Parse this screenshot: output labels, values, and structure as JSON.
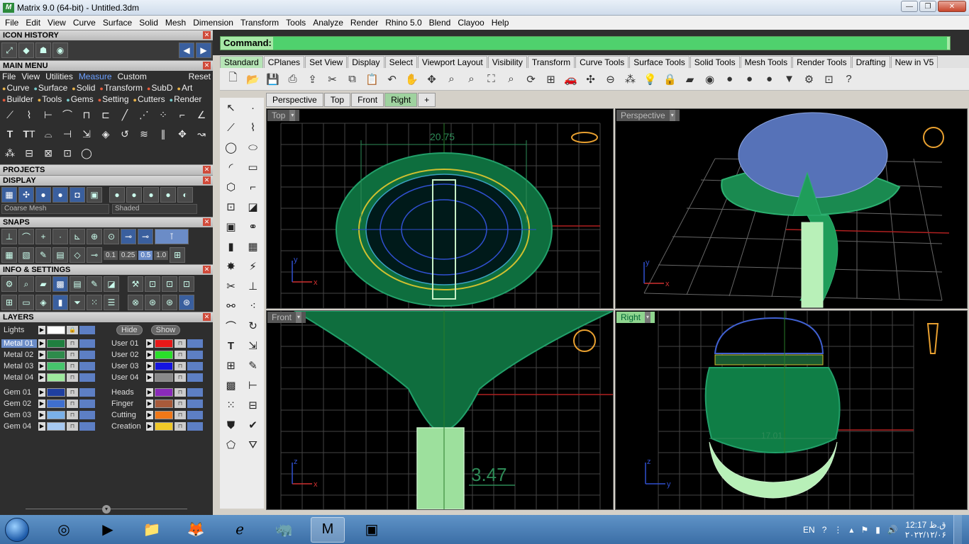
{
  "window": {
    "title": "Matrix 9.0 (64-bit) - Untitled.3dm",
    "minimize": "—",
    "maximize": "❐",
    "close": "✕"
  },
  "menubar": [
    "File",
    "Edit",
    "View",
    "Curve",
    "Surface",
    "Solid",
    "Mesh",
    "Dimension",
    "Transform",
    "Tools",
    "Analyze",
    "Render",
    "Rhino 5.0",
    "Blend",
    "Clayoo",
    "Help"
  ],
  "left_panel": {
    "icon_history": "ICON HISTORY",
    "main_menu": "MAIN MENU",
    "mm_menu": [
      "File",
      "View",
      "Utilities",
      "Measure",
      "Custom"
    ],
    "mm_reset": "Reset",
    "mm_cats_row1": [
      "Curve",
      "Surface",
      "Solid",
      "Transform",
      "SubD",
      "Art"
    ],
    "mm_cats_row2": [
      "Builder",
      "Tools",
      "Gems",
      "Setting",
      "Cutters",
      "Render"
    ],
    "projects": "PROJECTS",
    "display": "DISPLAY",
    "display_mesh": "Coarse Mesh",
    "display_shade": "Shaded",
    "snaps": "SNAPS",
    "snap_values": [
      "0.1",
      "0.25",
      "0.5",
      "1.0"
    ],
    "info_settings": "INFO & SETTINGS",
    "layers": "LAYERS",
    "hide": "Hide",
    "show": "Show",
    "layer_lights": "Lights",
    "layers_left": [
      {
        "name": "Metal 01",
        "color": "#1f7f3f"
      },
      {
        "name": "Metal 02",
        "color": "#2e8b4b"
      },
      {
        "name": "Metal 03",
        "color": "#46c46c"
      },
      {
        "name": "Metal 04",
        "color": "#9ee89e"
      },
      {
        "name": "Gem 01",
        "color": "#1f3f9f"
      },
      {
        "name": "Gem 02",
        "color": "#3f6fcf"
      },
      {
        "name": "Gem 03",
        "color": "#7ab0e8"
      },
      {
        "name": "Gem 04",
        "color": "#a6c8f0"
      }
    ],
    "layers_right": [
      {
        "name": "User 01",
        "color": "#e81818"
      },
      {
        "name": "User 02",
        "color": "#2adf2a"
      },
      {
        "name": "User 03",
        "color": "#1414e0"
      },
      {
        "name": "User 04",
        "color": "#8a8a8a"
      },
      {
        "name": "Heads",
        "color": "#8a2aba"
      },
      {
        "name": "Finger",
        "color": "#a85a3a"
      },
      {
        "name": "Cutting",
        "color": "#f07818"
      },
      {
        "name": "Creation",
        "color": "#f0c828"
      }
    ]
  },
  "command": {
    "label": "Command:"
  },
  "toolbar_tabs": [
    "Standard",
    "CPlanes",
    "Set View",
    "Display",
    "Select",
    "Viewport Layout",
    "Visibility",
    "Transform",
    "Curve Tools",
    "Surface Tools",
    "Solid Tools",
    "Mesh Tools",
    "Render Tools",
    "Drafting",
    "New in V5"
  ],
  "viewport_tabs": [
    "Perspective",
    "Top",
    "Front",
    "Right",
    "+"
  ],
  "viewports": {
    "top": {
      "label": "Top",
      "dimension": "20.75"
    },
    "perspective": {
      "label": "Perspective"
    },
    "front": {
      "label": "Front",
      "dimension": "3.47"
    },
    "right": {
      "label": "Right",
      "dimension": "17.01"
    }
  },
  "axes": {
    "x": "x",
    "y": "y",
    "z": "z"
  },
  "taskbar": {
    "lang": "EN",
    "time": "12:17 ق.ظ",
    "date": "۲۰۲۲/۱۲/۰۶"
  }
}
